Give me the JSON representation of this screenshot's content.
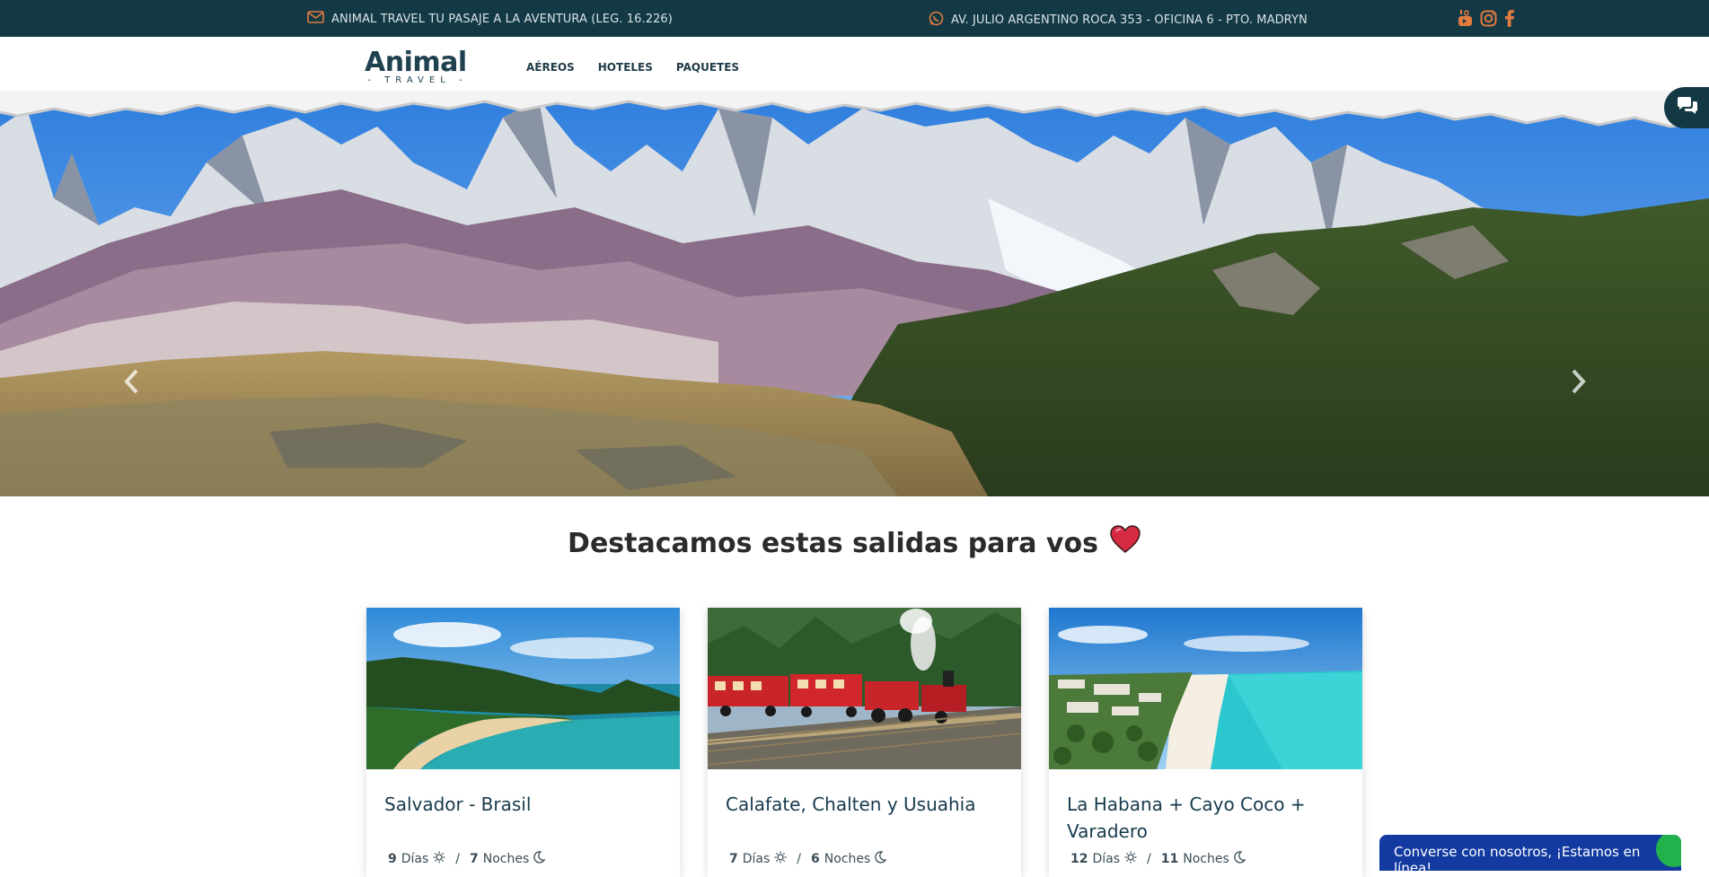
{
  "topbar": {
    "mail_text": "ANIMAL TRAVEL TU PASAJE A LA AVENTURA (LEG. 16.226)",
    "address_text": "AV. JULIO ARGENTINO ROCA 353 - OFICINA 6 - PTO. MADRYN",
    "social": [
      "youtube-icon",
      "instagram-icon",
      "facebook-icon"
    ]
  },
  "logo": {
    "word": "Animal",
    "sub": "- TRAVEL -"
  },
  "menu": [
    {
      "label": "AÉREOS"
    },
    {
      "label": "HOTELES"
    },
    {
      "label": "PAQUETES"
    }
  ],
  "section": {
    "title": "Destacamos estas salidas para vos"
  },
  "cards": [
    {
      "title": "Salvador - Brasil",
      "days": "9",
      "days_label": "Días",
      "nights": "7",
      "nights_label": "Noches"
    },
    {
      "title": "Calafate, Chalten y Usuahia",
      "days": "7",
      "days_label": "Días",
      "nights": "6",
      "nights_label": "Noches"
    },
    {
      "title": "La Habana + Cayo Coco + Varadero",
      "days": "12",
      "days_label": "Días",
      "nights": "11",
      "nights_label": "Noches"
    }
  ],
  "chat": {
    "label": "Converse con nosotros, ¡Estamos en línea!"
  },
  "colors": {
    "topbar": "#133945",
    "accent": "#e07a3f",
    "chat": "#133aa0",
    "heart": "#d62b43"
  }
}
